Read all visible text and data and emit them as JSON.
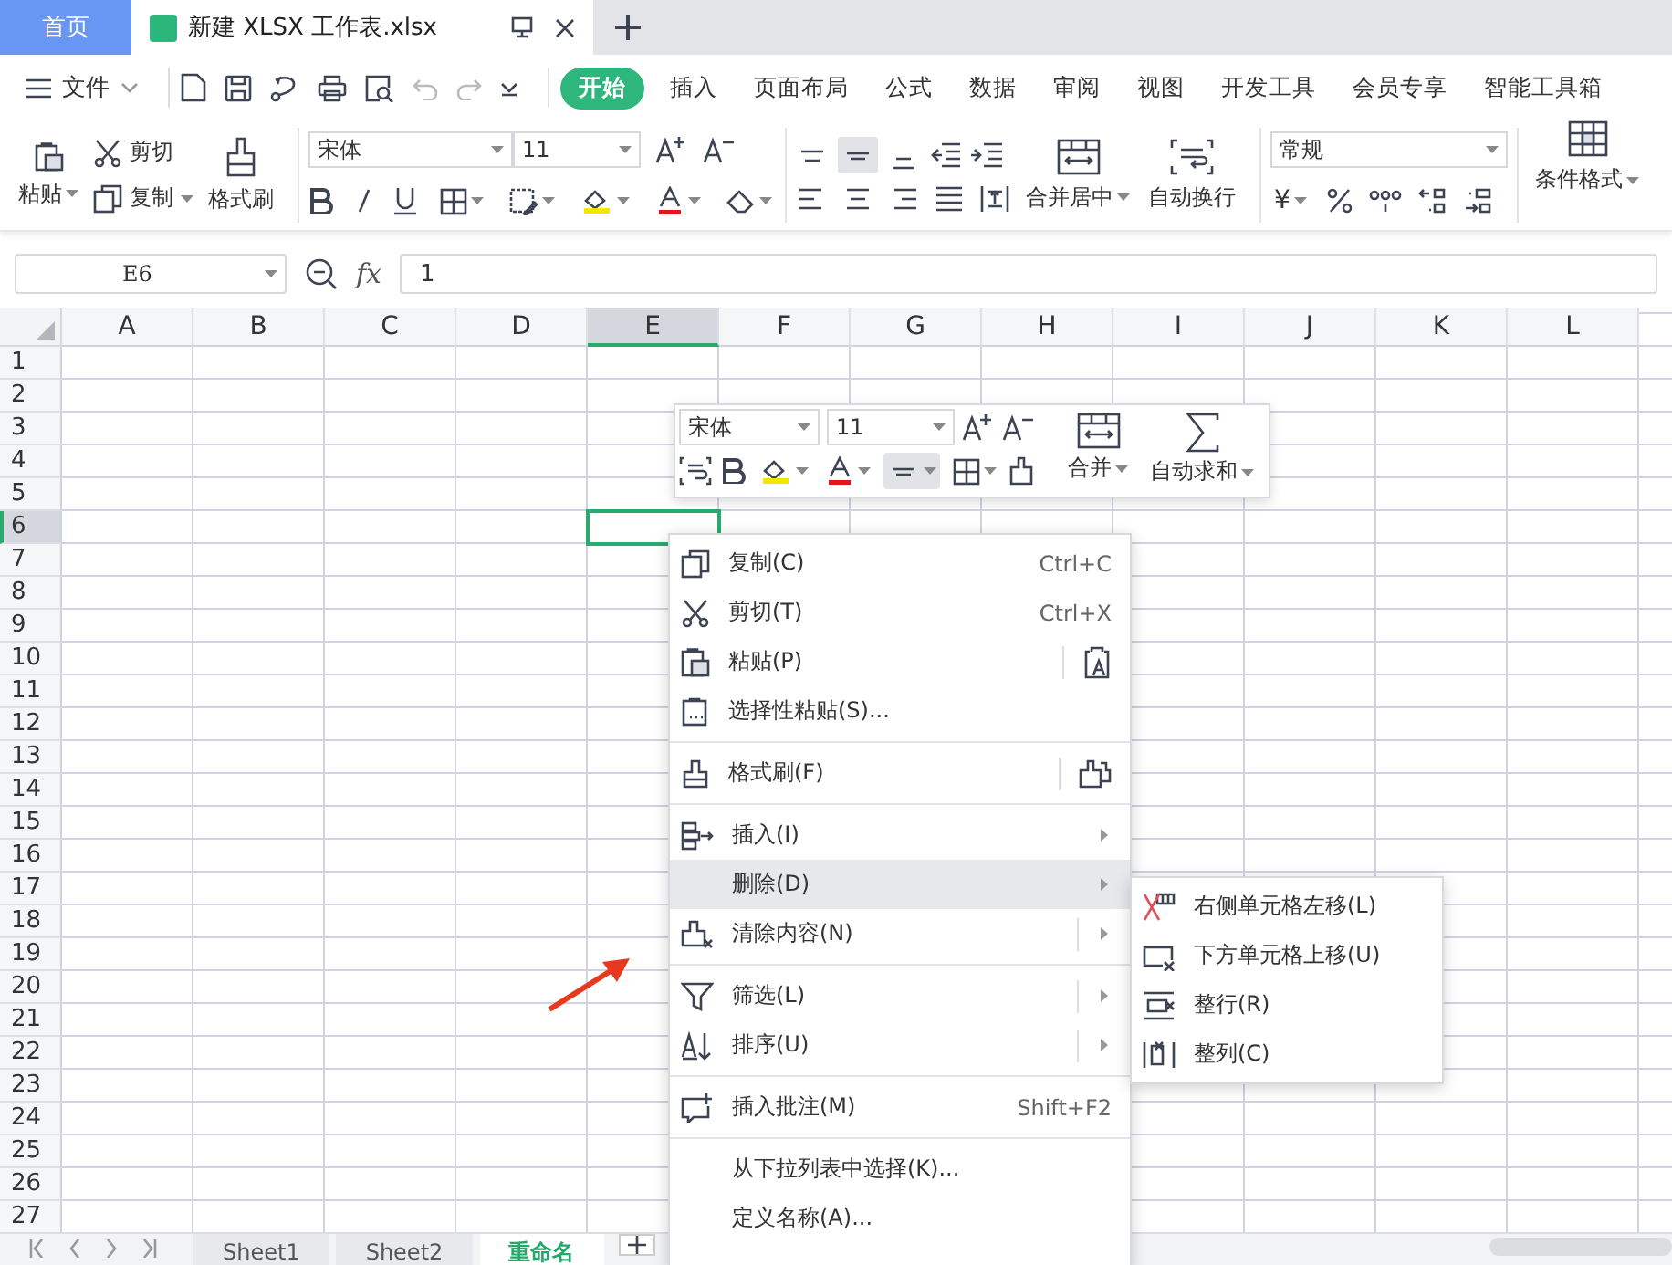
{
  "tabs": [
    {
      "label": "首页",
      "kind": "home",
      "selected": false
    },
    {
      "label": "新建 XLSX 工作表.xlsx",
      "kind": "doc",
      "selected": true
    }
  ],
  "menu": {
    "file": "文件",
    "tabs": [
      {
        "label": "开始",
        "selected": true
      },
      {
        "label": "插入",
        "selected": false
      },
      {
        "label": "页面布局",
        "selected": false
      },
      {
        "label": "公式",
        "selected": false
      },
      {
        "label": "数据",
        "selected": false
      },
      {
        "label": "审阅",
        "selected": false
      },
      {
        "label": "视图",
        "selected": false
      },
      {
        "label": "开发工具",
        "selected": false
      },
      {
        "label": "会员专享",
        "selected": false
      },
      {
        "label": "智能工具箱",
        "selected": false
      }
    ]
  },
  "ribbon": {
    "paste": "粘贴",
    "cut": "剪切",
    "copy": "复制",
    "format_painter": "格式刷",
    "font": "宋体",
    "size": "11",
    "merge": "合并居中",
    "wrap": "自动换行",
    "number_format": "常规",
    "currency": "¥",
    "conditional": "条件格式"
  },
  "formula_bar": {
    "cell": "E6",
    "function_label": "fx",
    "value": "1"
  },
  "columns": [
    {
      "label": "A",
      "selected": false
    },
    {
      "label": "B",
      "selected": false
    },
    {
      "label": "C",
      "selected": false
    },
    {
      "label": "D",
      "selected": false
    },
    {
      "label": "E",
      "selected": true
    },
    {
      "label": "F",
      "selected": false
    },
    {
      "label": "G",
      "selected": false
    },
    {
      "label": "H",
      "selected": false
    },
    {
      "label": "I",
      "selected": false
    },
    {
      "label": "J",
      "selected": false
    },
    {
      "label": "K",
      "selected": false
    },
    {
      "label": "L",
      "selected": false
    }
  ],
  "rows": [
    {
      "label": "1",
      "selected": false
    },
    {
      "label": "2",
      "selected": false
    },
    {
      "label": "3",
      "selected": false
    },
    {
      "label": "4",
      "selected": false
    },
    {
      "label": "5",
      "selected": false
    },
    {
      "label": "6",
      "selected": true
    },
    {
      "label": "7",
      "selected": false
    },
    {
      "label": "8",
      "selected": false
    },
    {
      "label": "9",
      "selected": false
    },
    {
      "label": "10",
      "selected": false
    },
    {
      "label": "11",
      "selected": false
    },
    {
      "label": "12",
      "selected": false
    },
    {
      "label": "13",
      "selected": false
    },
    {
      "label": "14",
      "selected": false
    },
    {
      "label": "15",
      "selected": false
    },
    {
      "label": "16",
      "selected": false
    },
    {
      "label": "17",
      "selected": false
    },
    {
      "label": "18",
      "selected": false
    },
    {
      "label": "19",
      "selected": false
    },
    {
      "label": "20",
      "selected": false
    },
    {
      "label": "21",
      "selected": false
    },
    {
      "label": "22",
      "selected": false
    },
    {
      "label": "23",
      "selected": false
    },
    {
      "label": "24",
      "selected": false
    },
    {
      "label": "25",
      "selected": false
    },
    {
      "label": "26",
      "selected": false
    },
    {
      "label": "27",
      "selected": false
    }
  ],
  "mini_toolbar": {
    "font": "宋体",
    "size": "11",
    "merge": "合并",
    "autosum": "自动求和"
  },
  "context_menu": [
    {
      "kind": "item",
      "label": "复制(C)",
      "shortcut": "Ctrl+C",
      "selected": false
    },
    {
      "kind": "item",
      "label": "剪切(T)",
      "shortcut": "Ctrl+X",
      "selected": false
    },
    {
      "kind": "split",
      "label": "粘贴(P)",
      "selected": false
    },
    {
      "kind": "item",
      "label": "选择性粘贴(S)...",
      "selected": false
    },
    {
      "kind": "separator"
    },
    {
      "kind": "split",
      "label": "格式刷(F)",
      "selected": false
    },
    {
      "kind": "separator"
    },
    {
      "kind": "submenu",
      "label": "插入(I)",
      "selected": false
    },
    {
      "kind": "submenu",
      "label": "删除(D)",
      "selected": true
    },
    {
      "kind": "split_submenu",
      "label": "清除内容(N)",
      "selected": false
    },
    {
      "kind": "separator"
    },
    {
      "kind": "split_submenu",
      "label": "筛选(L)",
      "selected": false
    },
    {
      "kind": "split_submenu",
      "label": "排序(U)",
      "selected": false
    },
    {
      "kind": "separator"
    },
    {
      "kind": "item",
      "label": "插入批注(M)",
      "shortcut": "Shift+F2",
      "selected": false
    },
    {
      "kind": "separator"
    },
    {
      "kind": "item",
      "label": "从下拉列表中选择(K)...",
      "selected": false
    },
    {
      "kind": "item",
      "label": "定义名称(A)...",
      "selected": false
    }
  ],
  "submenu": [
    {
      "label": "右侧单元格左移(L)"
    },
    {
      "label": "下方单元格上移(U)"
    },
    {
      "label": "整行(R)"
    },
    {
      "label": "整列(C)"
    }
  ],
  "sheets": [
    {
      "label": "Sheet1",
      "selected": false
    },
    {
      "label": "Sheet2",
      "selected": false
    },
    {
      "label": "重命名",
      "selected": true
    }
  ]
}
